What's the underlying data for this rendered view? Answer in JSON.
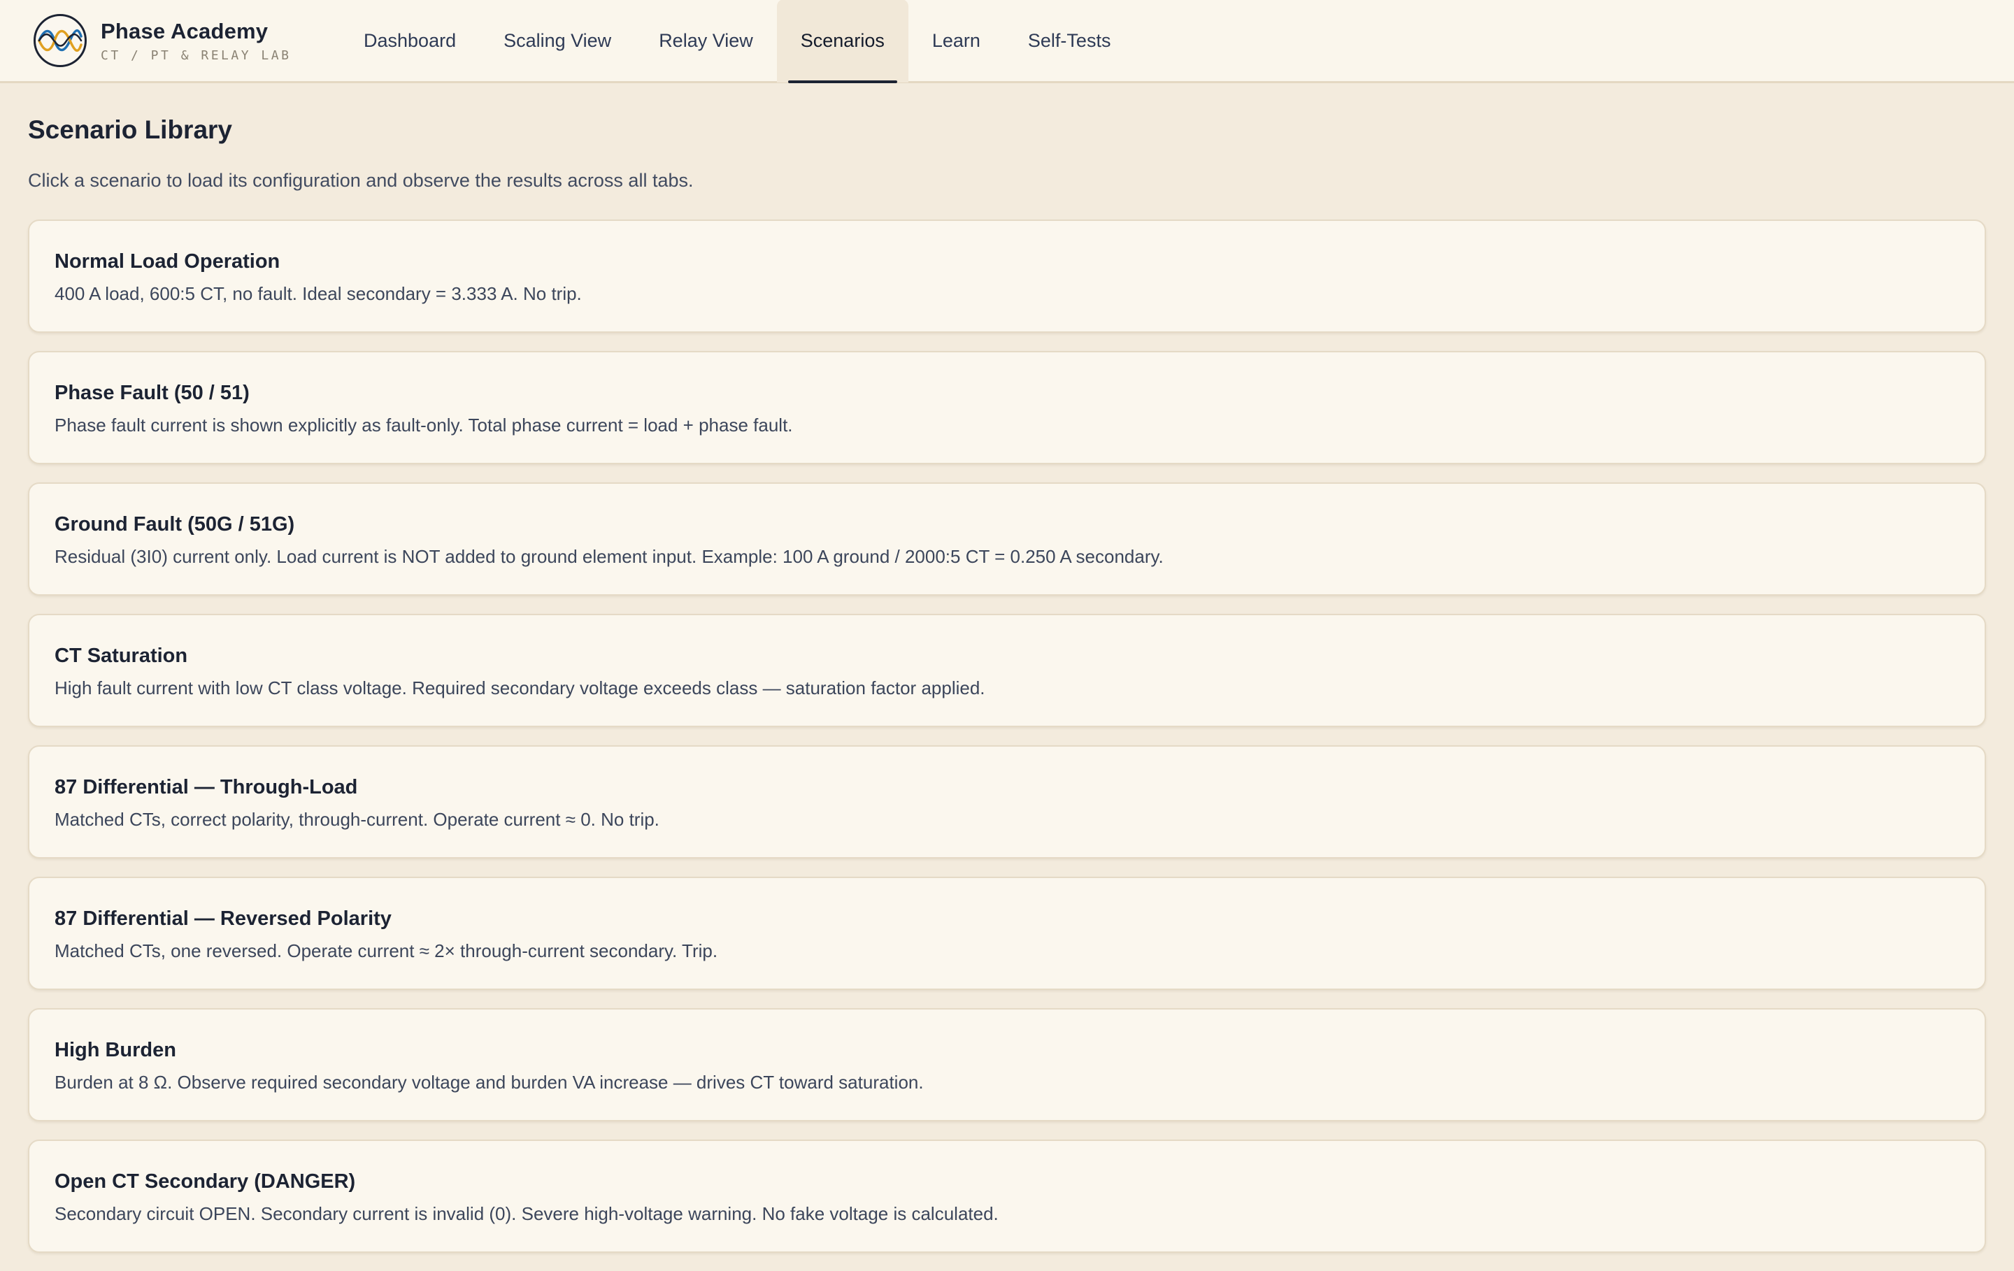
{
  "brand": {
    "title": "Phase Academy",
    "subtitle": "CT / PT & RELAY LAB",
    "logo_icon": "sine-wave-logo-icon",
    "logo_colors": [
      "#1f6fb2",
      "#e0a020"
    ]
  },
  "nav": {
    "tabs": [
      {
        "label": "Dashboard",
        "active": false
      },
      {
        "label": "Scaling View",
        "active": false
      },
      {
        "label": "Relay View",
        "active": false
      },
      {
        "label": "Scenarios",
        "active": true
      },
      {
        "label": "Learn",
        "active": false
      },
      {
        "label": "Self-Tests",
        "active": false
      }
    ]
  },
  "main": {
    "title": "Scenario Library",
    "description": "Click a scenario to load its configuration and observe the results across all tabs.",
    "scenarios": [
      {
        "title": "Normal Load Operation",
        "description": "400 A load, 600:5 CT, no fault. Ideal secondary = 3.333 A. No trip."
      },
      {
        "title": "Phase Fault (50 / 51)",
        "description": "Phase fault current is shown explicitly as fault-only. Total phase current = load + phase fault."
      },
      {
        "title": "Ground Fault (50G / 51G)",
        "description": "Residual (3I0) current only. Load current is NOT added to ground element input. Example: 100 A ground / 2000:5 CT = 0.250 A secondary."
      },
      {
        "title": "CT Saturation",
        "description": "High fault current with low CT class voltage. Required secondary voltage exceeds class — saturation factor applied."
      },
      {
        "title": "87 Differential — Through-Load",
        "description": "Matched CTs, correct polarity, through-current. Operate current ≈ 0. No trip."
      },
      {
        "title": "87 Differential — Reversed Polarity",
        "description": "Matched CTs, one reversed. Operate current ≈ 2× through-current secondary. Trip."
      },
      {
        "title": "High Burden",
        "description": "Burden at 8 Ω. Observe required secondary voltage and burden VA increase — drives CT toward saturation."
      },
      {
        "title": "Open CT Secondary (DANGER)",
        "description": "Secondary circuit OPEN. Secondary current is invalid (0). Severe high-voltage warning. No fake voltage is calculated."
      }
    ]
  }
}
